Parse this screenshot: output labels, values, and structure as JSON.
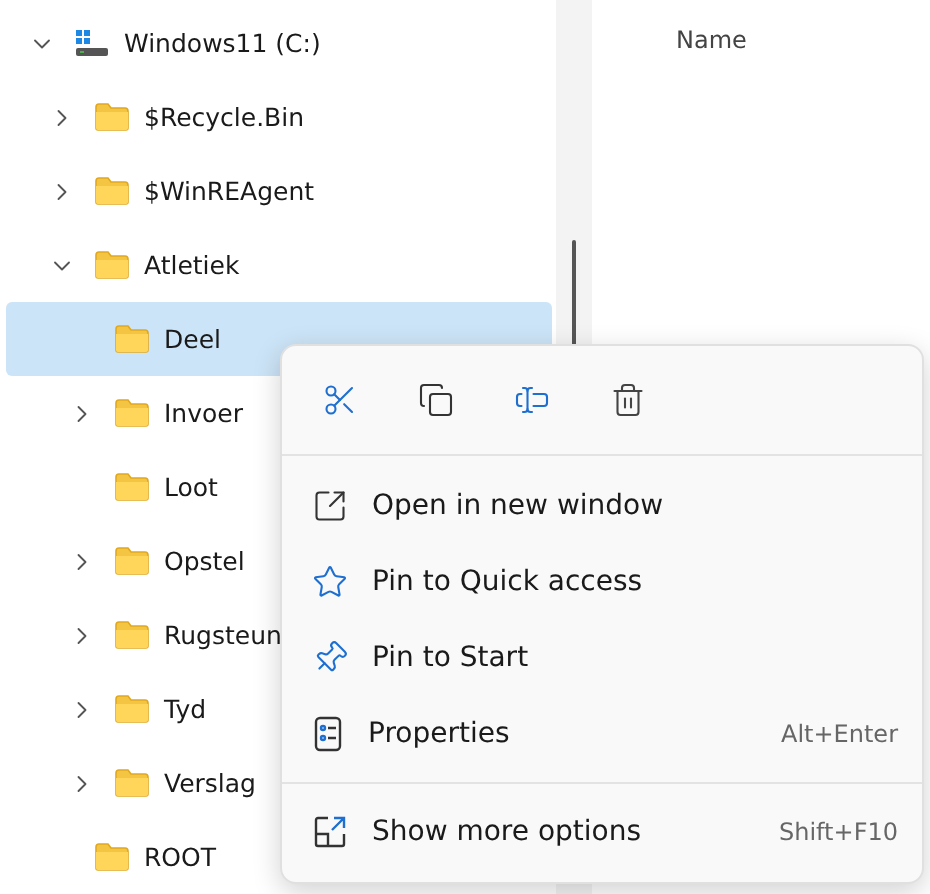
{
  "tree": [
    {
      "label": "Windows11 (C:)",
      "kind": "drive",
      "expandable": true,
      "expanded": true,
      "selected": false,
      "children": [
        {
          "label": "$Recycle.Bin",
          "kind": "folder",
          "expandable": true,
          "expanded": false,
          "selected": false
        },
        {
          "label": "$WinREAgent",
          "kind": "folder",
          "expandable": true,
          "expanded": false,
          "selected": false
        },
        {
          "label": "Atletiek",
          "kind": "folder",
          "expandable": true,
          "expanded": true,
          "selected": false,
          "children": [
            {
              "label": "Deel",
              "kind": "folder",
              "expandable": false,
              "selected": true
            },
            {
              "label": "Invoer",
              "kind": "folder",
              "expandable": true,
              "expanded": false,
              "selected": false
            },
            {
              "label": "Loot",
              "kind": "folder",
              "expandable": false,
              "selected": false
            },
            {
              "label": "Opstel",
              "kind": "folder",
              "expandable": true,
              "expanded": false,
              "selected": false
            },
            {
              "label": "Rugsteun",
              "kind": "folder",
              "expandable": true,
              "expanded": false,
              "selected": false
            },
            {
              "label": "Tyd",
              "kind": "folder",
              "expandable": true,
              "expanded": false,
              "selected": false
            },
            {
              "label": "Verslag",
              "kind": "folder",
              "expandable": true,
              "expanded": false,
              "selected": false
            }
          ]
        },
        {
          "label": "ROOT",
          "kind": "folder",
          "expandable": false,
          "selected": false
        }
      ]
    }
  ],
  "column_header": "Name",
  "context_menu": {
    "items": [
      {
        "label": "Open in new window"
      },
      {
        "label": "Pin to Quick access"
      },
      {
        "label": "Pin to Start"
      },
      {
        "label": "Properties",
        "shortcut": "Alt+Enter"
      }
    ],
    "footer": {
      "label": "Show more options",
      "shortcut": "Shift+F10"
    }
  }
}
